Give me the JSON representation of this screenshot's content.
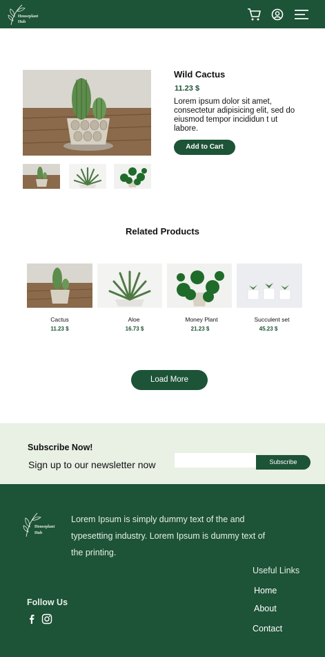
{
  "header": {
    "logo_line1": "Houseplant",
    "logo_line2": "Hub",
    "icons": [
      "cart-icon",
      "user-icon",
      "menu-icon"
    ],
    "bg_color": "#1d5337"
  },
  "product": {
    "title": "Wild Cactus",
    "price": "11.23 $",
    "description": "Lorem ipsum dolor sit amet, consectetur adipisicing elit, sed do eiusmod tempor incididun t ut labore.",
    "add_to_cart_label": "Add to Cart"
  },
  "related": {
    "title": "Related Products",
    "items": [
      {
        "name": "Cactus",
        "price": "11.23 $"
      },
      {
        "name": "Aloe",
        "price": "16.73 $"
      },
      {
        "name": "Money Plant",
        "price": "21.23 $"
      },
      {
        "name": "Succulent set",
        "price": "45.23 $"
      }
    ],
    "load_more_label": "Load More"
  },
  "subscribe": {
    "title": "Subscribe Now!",
    "text": "Sign up to our newsletter now",
    "input_value": "",
    "button_label": "Subscribe",
    "bg_color": "#e9f0e4"
  },
  "footer": {
    "logo_line1": "Houseplant",
    "logo_line2": "Hub",
    "description": "Lorem Ipsum is simply dummy text of the and typesetting industry. Lorem Ipsum is dummy text of the printing.",
    "useful_links_title": "Useful Links",
    "links": [
      "Home",
      "About",
      "Contact"
    ],
    "follow_us_title": "Follow Us",
    "social_icons": [
      "facebook-icon",
      "instagram-icon"
    ]
  }
}
